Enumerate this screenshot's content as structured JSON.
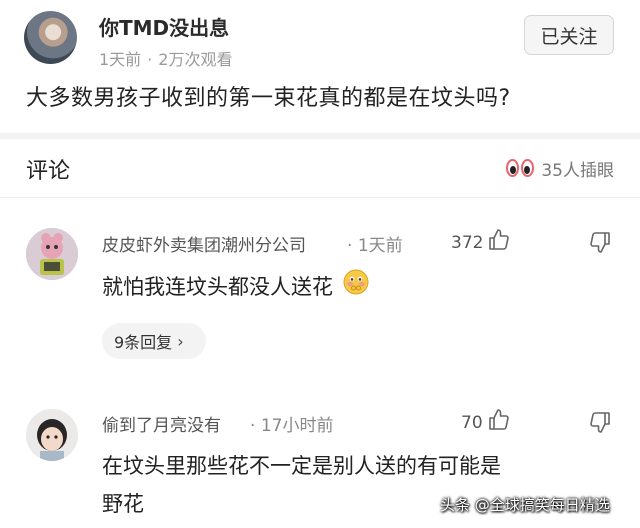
{
  "post": {
    "author": "你TMD没出息",
    "time": "1天前",
    "views": "2万次观看",
    "follow_label": "已关注",
    "title": "大多数男孩子收到的第一束花真的都是在坟头吗?"
  },
  "comments_section": {
    "title": "评论",
    "watchers": "35人插眼"
  },
  "comments": [
    {
      "author": "皮皮虾外卖集团潮州分公司",
      "time": "1天前",
      "likes": "372",
      "text": "就怕我连坟头都没人送花",
      "replies_label": "9条回复"
    },
    {
      "author": "偷到了月亮没有",
      "time": "17小时前",
      "likes": "70",
      "text_line1": "在坟头里那些花不一定是别人送的有可能是",
      "text_line2": "野花"
    }
  ],
  "watermark": "头条 @全球搞笑每日精选",
  "colors": {
    "accent_eyes": "#e6646e",
    "divider": "#ededed",
    "background": "#ffffff"
  }
}
